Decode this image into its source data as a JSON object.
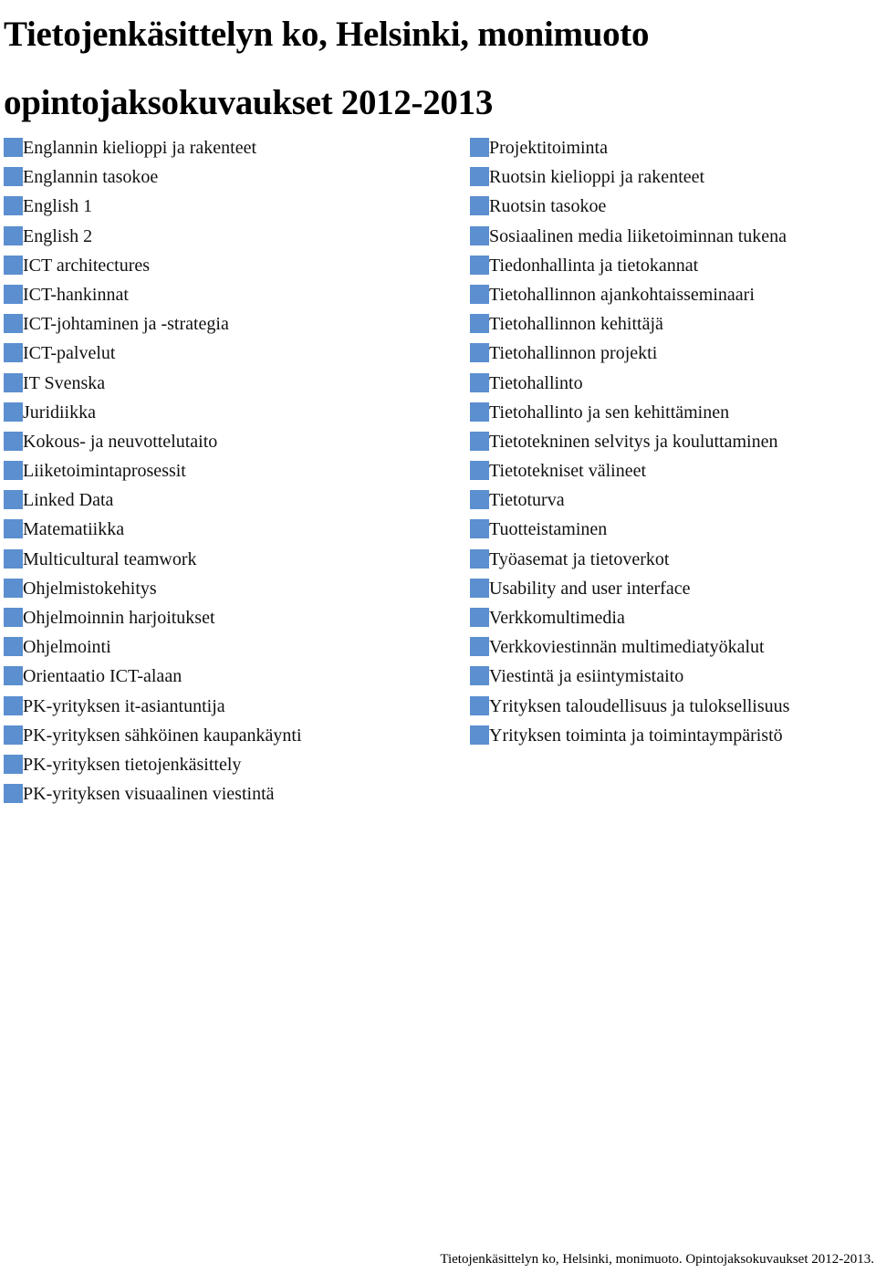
{
  "document": {
    "title_line1": "Tietojenkäsittelyn ko, Helsinki, monimuoto",
    "title_line2": "opintojaksokuvaukset 2012-2013",
    "bullet_color": "#5b8fd0",
    "left_column": [
      "Englannin kielioppi ja rakenteet",
      "Englannin tasokoe",
      "English 1",
      "English 2",
      "ICT architectures",
      "ICT-hankinnat",
      "ICT-johtaminen ja -strategia",
      "ICT-palvelut",
      "IT Svenska",
      "Juridiikka",
      "Kokous- ja neuvottelutaito",
      "Liiketoimintaprosessit",
      "Linked Data",
      "Matematiikka",
      "Multicultural teamwork",
      "Ohjelmistokehitys",
      "Ohjelmoinnin harjoitukset",
      "Ohjelmointi",
      "Orientaatio ICT-alaan",
      "PK-yrityksen it-asiantuntija",
      "PK-yrityksen sähköinen kaupankäynti",
      "PK-yrityksen tietojenkäsittely",
      "PK-yrityksen visuaalinen viestintä"
    ],
    "right_column": [
      "Projektitoiminta",
      "Ruotsin kielioppi ja rakenteet",
      "Ruotsin tasokoe",
      "Sosiaalinen media liiketoiminnan tukena",
      "Tiedonhallinta ja tietokannat",
      "Tietohallinnon ajankohtaisseminaari",
      "Tietohallinnon kehittäjä",
      "Tietohallinnon projekti",
      "Tietohallinto",
      "Tietohallinto ja sen kehittäminen",
      "Tietotekninen selvitys ja kouluttaminen",
      "Tietotekniset välineet",
      "Tietoturva",
      "Tuotteistaminen",
      "Työasemat ja tietoverkot",
      "Usability and user interface",
      "Verkkomultimedia",
      "Verkkoviestinnän multimediatyökalut",
      "Viestintä ja esiintymistaito",
      "Yrityksen taloudellisuus ja tuloksellisuus",
      "Yrityksen toiminta ja toimintaympäristö"
    ],
    "footer": "Tietojenkäsittelyn ko, Helsinki, monimuoto. Opintojaksokuvaukset 2012-2013."
  }
}
